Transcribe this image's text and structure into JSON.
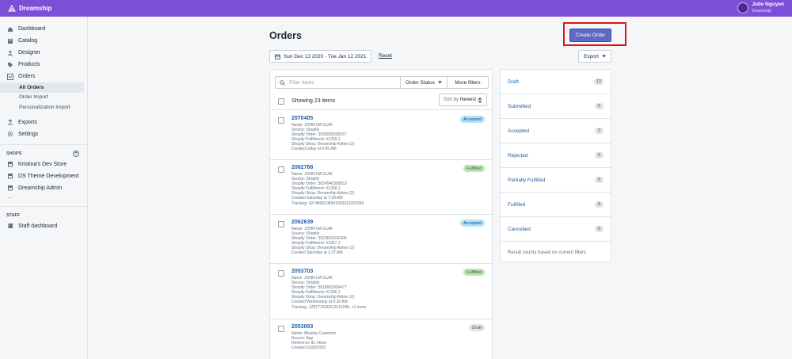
{
  "topbar": {
    "brand": "Dreamship",
    "user_name": "Julie Nguyen",
    "user_org": "Dreamship"
  },
  "sidebar": {
    "items": [
      {
        "label": "Dashboard",
        "icon": "home-icon"
      },
      {
        "label": "Catalog",
        "icon": "catalog-icon"
      },
      {
        "label": "Designer",
        "icon": "designer-icon"
      },
      {
        "label": "Products",
        "icon": "tag-icon"
      },
      {
        "label": "Orders",
        "icon": "orders-icon"
      }
    ],
    "order_sub": [
      "All Orders",
      "Order Import",
      "Personalization Import"
    ],
    "items2": [
      {
        "label": "Exports",
        "icon": "export-icon"
      },
      {
        "label": "Settings",
        "icon": "gear-icon"
      }
    ],
    "shops_label": "SHOPS",
    "shops": [
      "Kristina's Dev Store",
      "DS Theme Development",
      "Dreamship Admin"
    ],
    "more": "...",
    "staff_label": "STAFF",
    "staff_item": "Staff dashboard"
  },
  "page": {
    "title": "Orders",
    "create_button": "Create Order",
    "date_range": "Sun Dec 13 2020 - Tue Jan 12 2021",
    "reset": "Reset",
    "export": "Export"
  },
  "filters": {
    "search_placeholder": "Filter items",
    "order_status": "Order Status",
    "more_filters": "More filters",
    "showing": "Showing 23 items",
    "sort_label": "Sort by",
    "sort_value": "Newest"
  },
  "orders": [
    {
      "number": "2070405",
      "status": "Accepted",
      "status_kind": "accepted",
      "lines": [
        "Name: JOHN DA GUIA",
        "Source: Shopify",
        "Shopify Order: 3030095659157",
        "Shopify Fulfillment: #1259.1",
        "Shopify Shop: Dreamship Admin (2)",
        "Created today at 6:05 AM"
      ]
    },
    {
      "number": "2062768",
      "status": "Fulfilled",
      "status_kind": "fulfilled",
      "lines": [
        "Name: JOHN DA GUIA",
        "Source: Shopify",
        "Shopify Order: 3024546300053",
        "Shopify Fulfillment: #1258.1",
        "Shopify Shop: Dreamship Admin (2)",
        "Created Saturday at 7:30 AM",
        "Tracking: 9274890108901553031202084"
      ]
    },
    {
      "number": "2062639",
      "status": "Accepted",
      "status_kind": "accepted",
      "lines": [
        "Name: JOHN DA GUIA",
        "Source: Shopify",
        "Shopify Order: 3023816032405",
        "Shopify Fulfillment: #1257.1",
        "Shopify Shop: Dreamship Admin (2)",
        "Created Saturday at 1:37 AM"
      ]
    },
    {
      "number": "2053703",
      "status": "Fulfilled",
      "status_kind": "fulfilled",
      "lines": [
        "Name: JOHN DA GUIA",
        "Source: Shopify",
        "Shopify Order: 3018003939477",
        "Shopify Fulfillment: #1256.1",
        "Shopify Shop: Dreamship Admin (2)",
        "Created Wednesday at 6:10 AM",
        "Tracking: 1Z8771R30312141049, +1 more"
      ]
    },
    {
      "number": "2053093",
      "status": "Draft",
      "status_kind": "draft",
      "lines": [
        "Name: Missing Customer",
        "Source: App",
        "Reference ID: None",
        "Created 01/05/2021"
      ]
    }
  ],
  "summary": {
    "rows": [
      {
        "label": "Draft",
        "count": "13"
      },
      {
        "label": "Submitted",
        "count": "0"
      },
      {
        "label": "Accepted",
        "count": "2"
      },
      {
        "label": "Rejected",
        "count": "0"
      },
      {
        "label": "Partially Fulfilled",
        "count": "0"
      },
      {
        "label": "Fulfilled",
        "count": "8"
      },
      {
        "label": "Cancelled",
        "count": "0"
      }
    ],
    "note": "Result counts based on current filters"
  },
  "colors": {
    "topbar": "#7b4fd8",
    "primary_button": "#5c6ac4",
    "highlight_box": "#e01313",
    "link": "#1f5fa8"
  }
}
